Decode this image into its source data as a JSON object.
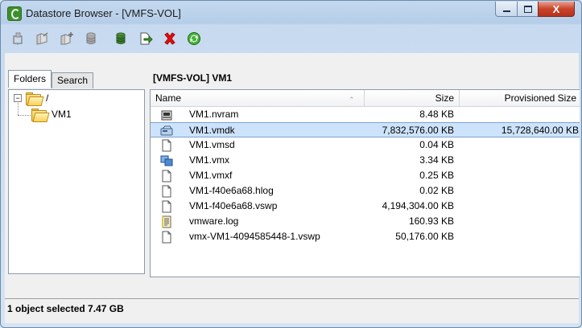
{
  "window": {
    "title": "Datastore Browser - [VMFS-VOL]",
    "close_glyph": "X"
  },
  "toolbar": {
    "buttons": [
      {
        "name": "browse-icon",
        "color": "#8a8a8a"
      },
      {
        "name": "upload-folder-icon",
        "color": "#8a8a8a"
      },
      {
        "name": "new-folder-icon",
        "color": "#8a8a8a"
      },
      {
        "name": "datastore-icon",
        "color": "#8a8a8a"
      },
      {
        "name": "download-icon",
        "color": "#3b7f2c"
      },
      {
        "name": "move-icon",
        "color": "#3b7f2c"
      },
      {
        "name": "delete-icon",
        "color": "#e01010"
      },
      {
        "name": "refresh-icon",
        "color": "#2f9b2f"
      }
    ]
  },
  "tabs": [
    {
      "label": "Folders",
      "active": true
    },
    {
      "label": "Search",
      "active": false
    }
  ],
  "tree": {
    "root_label": "/",
    "root_expander": "−",
    "child_label": "VM1"
  },
  "path": "[VMFS-VOL] VM1",
  "columns": {
    "name": "Name",
    "size": "Size",
    "provisioned": "Provisioned Size"
  },
  "files": [
    {
      "icon": "nvram-icon",
      "name": "VM1.nvram",
      "size": "8.48 KB",
      "provisioned": "",
      "selected": false
    },
    {
      "icon": "virtual-disk-icon",
      "name": "VM1.vmdk",
      "size": "7,832,576.00 KB",
      "provisioned": "15,728,640.00 KB",
      "selected": true
    },
    {
      "icon": "file-icon",
      "name": "VM1.vmsd",
      "size": "0.04 KB",
      "provisioned": "",
      "selected": false
    },
    {
      "icon": "vm-config-icon",
      "name": "VM1.vmx",
      "size": "3.34 KB",
      "provisioned": "",
      "selected": false
    },
    {
      "icon": "file-icon",
      "name": "VM1.vmxf",
      "size": "0.25 KB",
      "provisioned": "",
      "selected": false
    },
    {
      "icon": "file-icon",
      "name": "VM1-f40e6a68.hlog",
      "size": "0.02 KB",
      "provisioned": "",
      "selected": false
    },
    {
      "icon": "file-icon",
      "name": "VM1-f40e6a68.vswp",
      "size": "4,194,304.00 KB",
      "provisioned": "",
      "selected": false
    },
    {
      "icon": "log-icon",
      "name": "vmware.log",
      "size": "160.93 KB",
      "provisioned": "",
      "selected": false
    },
    {
      "icon": "file-icon",
      "name": "vmx-VM1-4094585448-1.vswp",
      "size": "50,176.00 KB",
      "provisioned": "",
      "selected": false
    }
  ],
  "status": "1 object selected 7.47 GB"
}
